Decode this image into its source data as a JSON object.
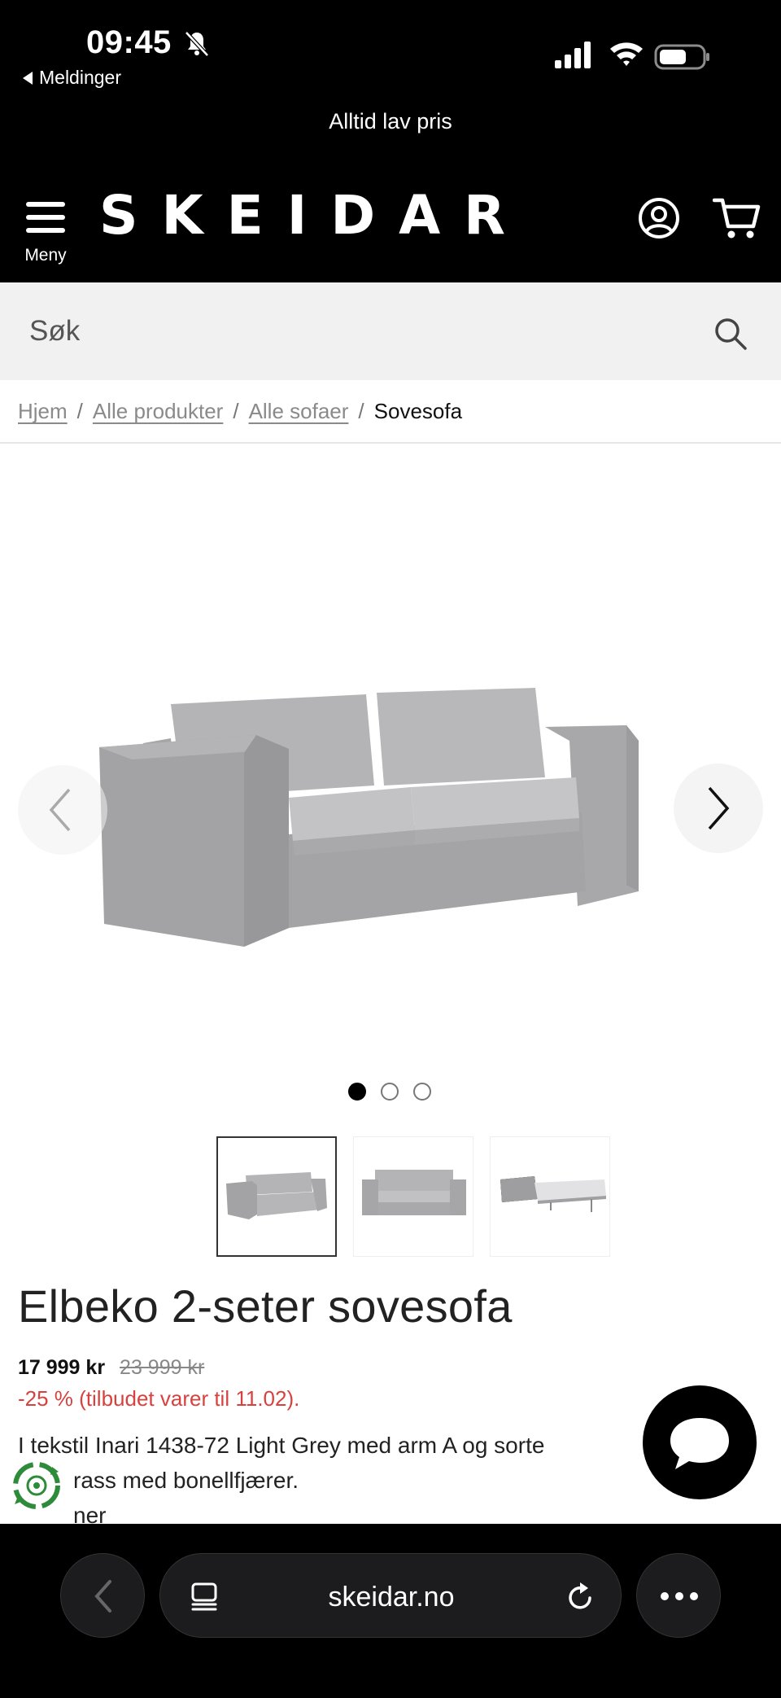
{
  "status_bar": {
    "time": "09:45",
    "back_app": "Meldinger"
  },
  "header": {
    "promo": "Alltid lav pris",
    "menu_label": "Meny",
    "logo": "SKEIDAR"
  },
  "search": {
    "placeholder": "Søk"
  },
  "breadcrumb": {
    "items": [
      "Hjem",
      "Alle produkter",
      "Alle sofaer"
    ],
    "current": "Sovesofa",
    "separator": "/"
  },
  "gallery": {
    "slide_count": 3,
    "active_slide": 1
  },
  "product": {
    "title": "Elbeko 2-seter sovesofa",
    "price": "17 999 kr",
    "old_price": "23 999 kr",
    "discount": "-25 % (tilbudet varer til 11.02).",
    "description_lines": [
      "I tekstil Inari 1438-72 Light Grey med arm A og sorte",
      "rass med bonellfjærer.",
      "ner"
    ]
  },
  "browser": {
    "url": "skeidar.no"
  },
  "colors": {
    "header_bg": "#000000",
    "discount": "#d8423e",
    "search_bg": "#f1f1f1",
    "recycle": "#2e8b3a"
  }
}
